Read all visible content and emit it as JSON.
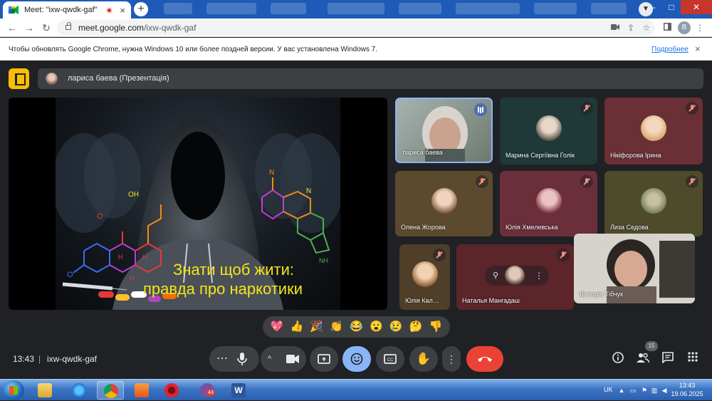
{
  "browser": {
    "tab_title": "Meet: \"ixw-qwdk-gaf\"",
    "tab_close": "×",
    "new_tab": "+",
    "url_host": "meet.google.com",
    "url_path": "/ixw-qwdk-gaf",
    "profile_letter": "B",
    "window_controls": {
      "minimize": "–",
      "maximize": "□",
      "close": "✕"
    }
  },
  "infobar": {
    "message": "Чтобы обновлять Google Chrome, нужна Windows 10 или более поздней версии. У вас установлена Windows 7.",
    "link": "Подробнее",
    "close": "×"
  },
  "presentation": {
    "presenter_label": "лариса баева (Презентація)"
  },
  "slide": {
    "line1": "Знати щоб жити:",
    "line2": "правда про наркотики",
    "chem_labels": [
      "OH",
      "O",
      "O",
      "N",
      "H",
      "H",
      "H",
      "NH",
      "N"
    ]
  },
  "participants": [
    {
      "name": "лариса баева",
      "state": "speaking"
    },
    {
      "name": "Марина Сергіївна Голік",
      "state": "muted"
    },
    {
      "name": "Нікіфорова Ірина",
      "state": "muted"
    },
    {
      "name": "Олена Жорова",
      "state": "muted"
    },
    {
      "name": "Юлія Хмелевська",
      "state": "muted"
    },
    {
      "name": "Лиза Седова",
      "state": "muted"
    },
    {
      "name": "Юлія Кал…",
      "state": "muted"
    },
    {
      "name": "Наталья Мангадаш",
      "state": "muted"
    },
    {
      "name": "Вікторія Тібчук",
      "state": "video"
    }
  ],
  "reactions": [
    "💖",
    "👍",
    "🎉",
    "👏",
    "😂",
    "😮",
    "😢",
    "🤔",
    "👎"
  ],
  "controls": {
    "time": "13:43",
    "separator": "|",
    "meeting_code": "ixw-qwdk-gaf",
    "more_dots": "⋯",
    "people_count": "15"
  },
  "taskbar": {
    "language": "UK",
    "time": "13:43",
    "date": "19.06.2025",
    "viber_badge": "43"
  },
  "colors": {
    "meet_bg": "#202124",
    "accent_blue": "#8ab4f8",
    "end_call_red": "#ea4335",
    "slide_text": "#f4e51c",
    "presentation_icon": "#fbbc04"
  }
}
